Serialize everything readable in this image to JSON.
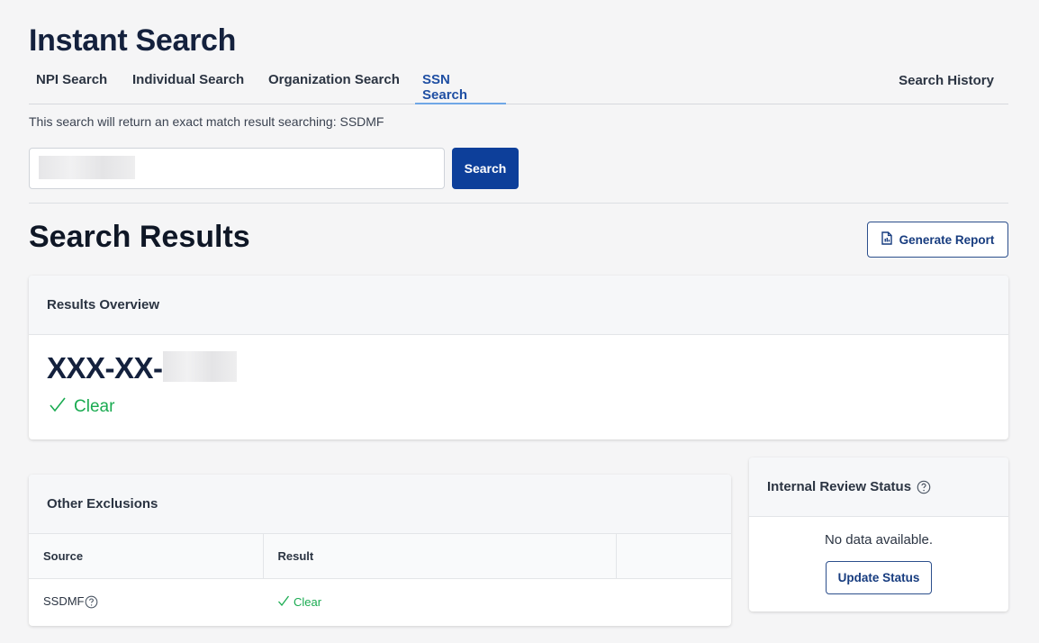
{
  "page": {
    "title": "Instant Search"
  },
  "tabs": [
    {
      "label": "NPI Search"
    },
    {
      "label": "Individual Search"
    },
    {
      "label": "Organization Search"
    },
    {
      "label": "SSN Search",
      "active": true
    }
  ],
  "search_history_label": "Search History",
  "helper_text": "This search will return an exact match result searching: SSDMF",
  "search": {
    "button_label": "Search",
    "value": ""
  },
  "results": {
    "title": "Search Results",
    "generate_report_label": "Generate Report",
    "overview": {
      "header": "Results Overview",
      "ssn_prefix": "XXX-XX-",
      "status": "Clear"
    },
    "other_exclusions": {
      "header": "Other Exclusions",
      "columns": [
        "Source",
        "Result",
        ""
      ],
      "rows": [
        {
          "source": "SSDMF",
          "result": "Clear"
        }
      ]
    },
    "internal_review": {
      "header": "Internal Review Status",
      "empty_text": "No data available.",
      "button_label": "Update Status"
    }
  },
  "colors": {
    "accent": "#0d3f9a",
    "clear_green": "#1aab51",
    "tab_active": "#1f4fa3"
  }
}
